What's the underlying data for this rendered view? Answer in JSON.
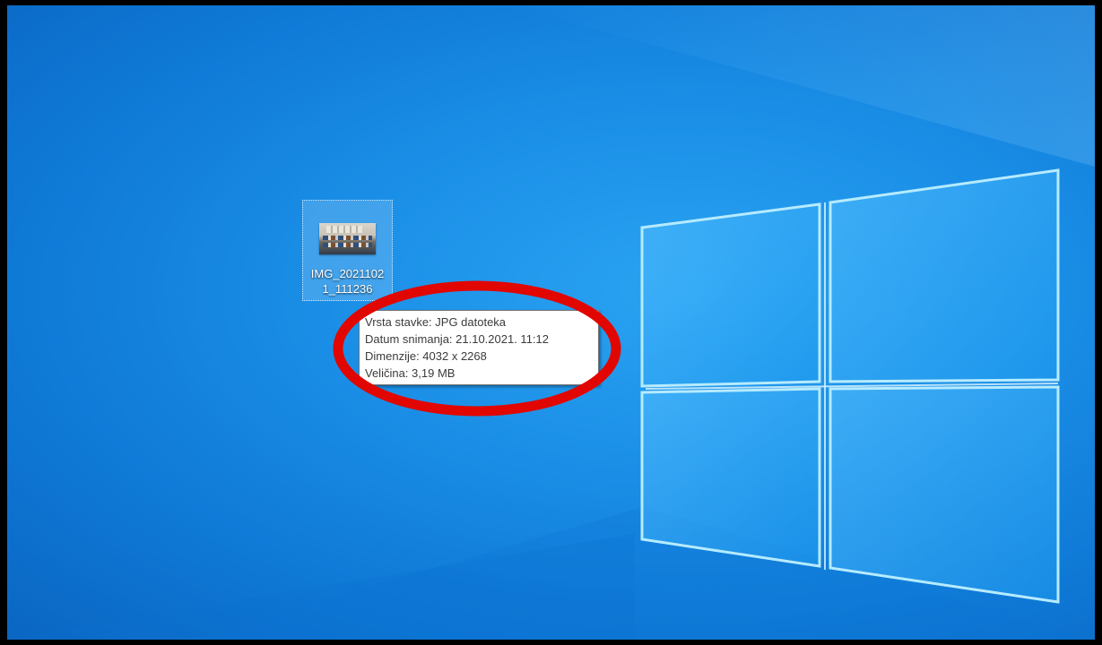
{
  "desktop": {
    "icon": {
      "name": "IMG_20211021_111236",
      "label_line1": "IMG_2021102",
      "label_line2": "1_111236",
      "icon": "image-thumbnail"
    }
  },
  "tooltip": {
    "item_type": "Vrsta stavke: JPG datoteka",
    "date_taken": "Datum snimanja: 21.10.2021. 11:12",
    "dimensions": "Dimenzije: 4032 x 2268",
    "size": "Veličina: 3,19 MB"
  },
  "annotation": {
    "highlight_color": "#e10600"
  },
  "colors": {
    "desktop_blue": "#1a8ee6",
    "window_logo": "#aee4ff"
  }
}
